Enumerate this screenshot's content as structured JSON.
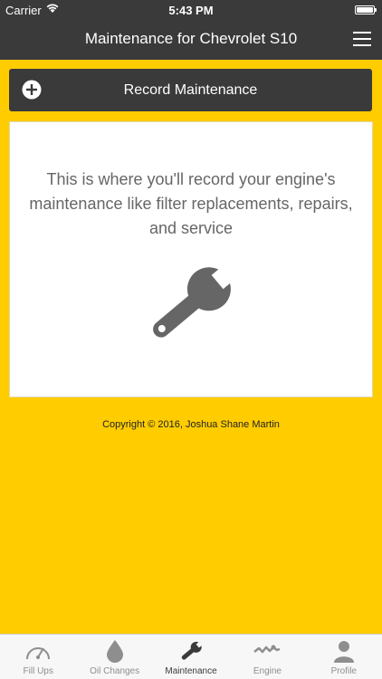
{
  "status_bar": {
    "carrier": "Carrier",
    "time": "5:43 PM",
    "battery_level": 1.0
  },
  "nav": {
    "title": "Maintenance for Chevrolet S10",
    "menu_icon": "hamburger-menu-icon"
  },
  "record_button": {
    "label": "Record Maintenance",
    "icon": "plus-circle-icon"
  },
  "empty_state": {
    "message": "This is where you'll record your engine's maintenance like filter replacements, repairs, and service",
    "icon": "wrench-icon"
  },
  "footer": {
    "copyright": "Copyright © 2016, Joshua Shane Martin"
  },
  "tabs": [
    {
      "label": "Fill Ups",
      "icon": "gauge-icon",
      "active": false
    },
    {
      "label": "Oil Changes",
      "icon": "oil-drop-icon",
      "active": false
    },
    {
      "label": "Maintenance",
      "icon": "wrench-icon",
      "active": true
    },
    {
      "label": "Engine",
      "icon": "engine-icon",
      "active": false
    },
    {
      "label": "Profile",
      "icon": "person-icon",
      "active": false
    }
  ],
  "colors": {
    "bar_background": "#3a3a3a",
    "content_background": "#ffcc00",
    "card_background": "#ffffff",
    "message_text": "#666666",
    "tab_inactive": "#8e8e8e",
    "tab_active": "#3a3a3a"
  }
}
